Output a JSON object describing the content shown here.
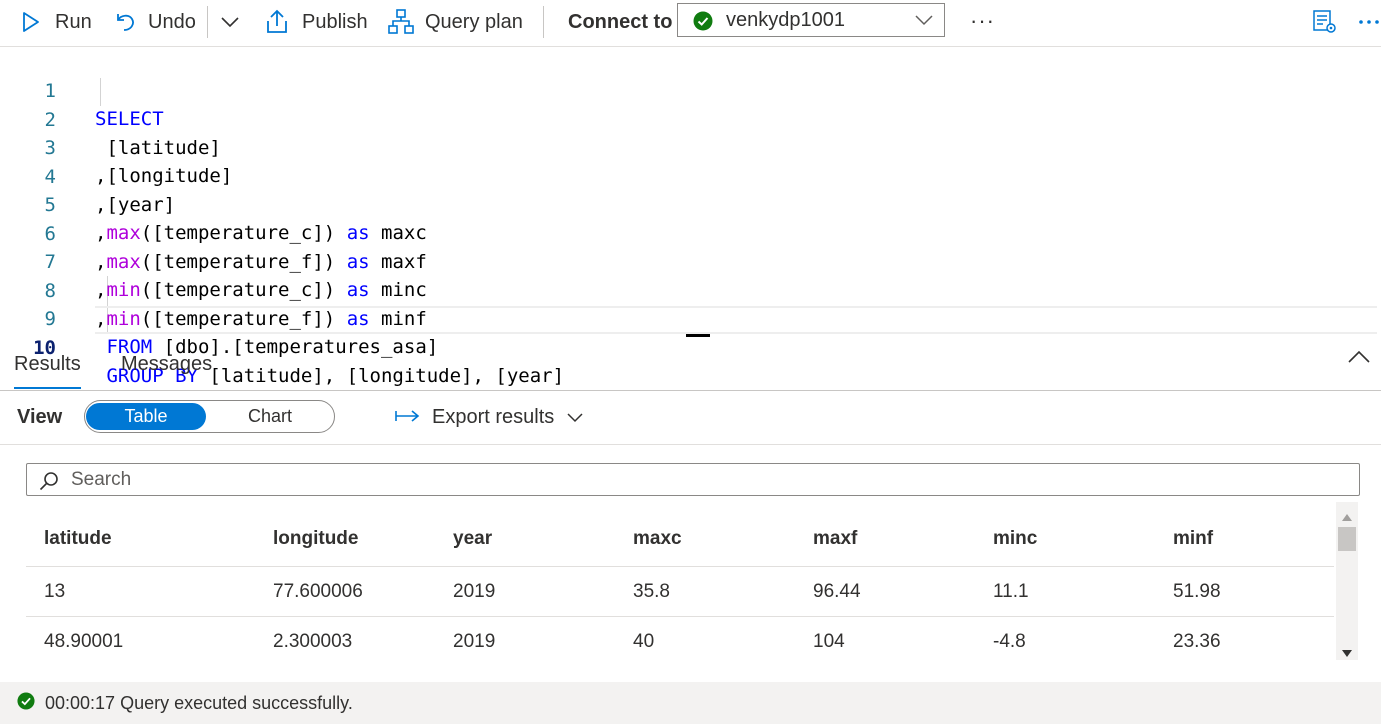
{
  "toolbar": {
    "run_label": "Run",
    "undo_label": "Undo",
    "publish_label": "Publish",
    "query_plan_label": "Query plan",
    "connect_to_label": "Connect to",
    "database_selected": "venkydp1001",
    "more_label": "···",
    "icons": {
      "run": "play-icon",
      "undo": "undo-icon",
      "dropdown": "chevron-down-icon",
      "publish": "upload-icon",
      "query_plan": "hierarchy-icon",
      "status": "check-circle-icon",
      "properties": "properties-icon",
      "more": "ellipsis-icon"
    }
  },
  "editor": {
    "lines": [
      {
        "number": "1",
        "text": "SELECT"
      },
      {
        "number": "2",
        "text": " [latitude]"
      },
      {
        "number": "3",
        "text": ",[longitude]"
      },
      {
        "number": "4",
        "text": ",[year]"
      },
      {
        "number": "5",
        "text": ",max([temperature_c]) as maxc"
      },
      {
        "number": "6",
        "text": ",max([temperature_f]) as maxf"
      },
      {
        "number": "7",
        "text": ",min([temperature_c]) as minc"
      },
      {
        "number": "8",
        "text": ",min([temperature_f]) as minf"
      },
      {
        "number": "9",
        "text": " FROM [dbo].[temperatures_asa]"
      },
      {
        "number": "10",
        "text": " GROUP BY [latitude], [longitude], [year]"
      }
    ],
    "active_line": 10
  },
  "results": {
    "tabs": [
      "Results",
      "Messages"
    ],
    "active_tab": "Results",
    "view_label": "View",
    "view_options": [
      "Table",
      "Chart"
    ],
    "view_selected": "Table",
    "export_label": "Export results",
    "search_placeholder": "Search",
    "columns": [
      "latitude",
      "longitude",
      "year",
      "maxc",
      "maxf",
      "minc",
      "minf"
    ],
    "rows": [
      [
        "13",
        "77.600006",
        "2019",
        "35.8",
        "96.44",
        "11.1",
        "51.98"
      ],
      [
        "48.90001",
        "2.300003",
        "2019",
        "40",
        "104",
        "-4.8",
        "23.36"
      ]
    ]
  },
  "status": {
    "text": "00:00:17 Query executed successfully.",
    "color": "#107c10"
  },
  "colors": {
    "accent": "#0078d4",
    "keyword": "#0000ff",
    "line_number": "#237893",
    "success": "#107c10"
  }
}
